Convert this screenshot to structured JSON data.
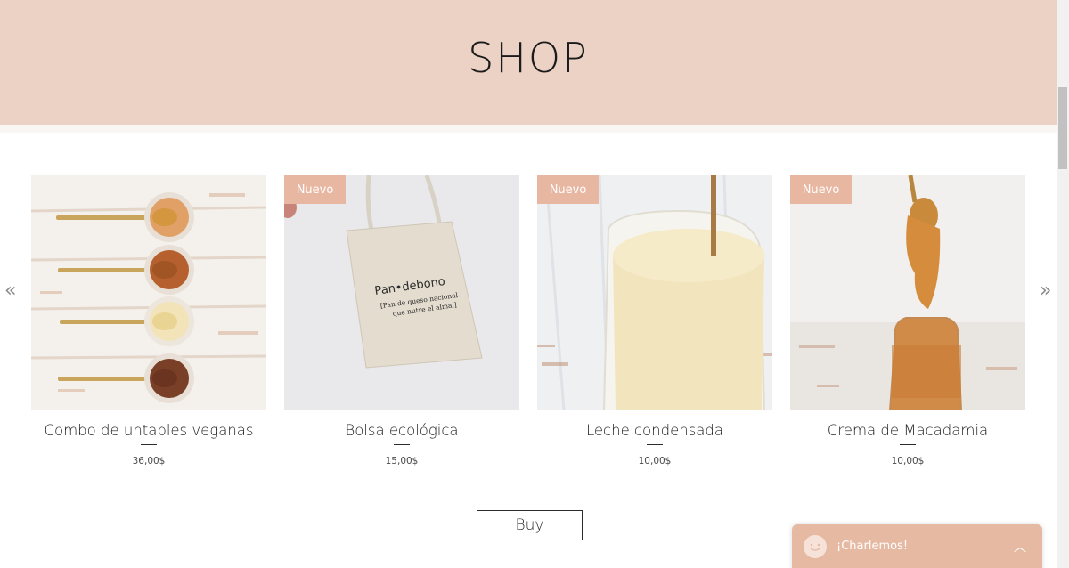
{
  "header": {
    "title": "SHOP"
  },
  "gallery": {
    "products": [
      {
        "name": "Combo de untables veganas",
        "price": "36,00$",
        "badge": ""
      },
      {
        "name": "Bolsa ecológica",
        "price": "15,00$",
        "badge": "Nuevo"
      },
      {
        "name": "Leche condensada",
        "price": "10,00$",
        "badge": "Nuevo"
      },
      {
        "name": "Crema de Macadamia",
        "price": "10,00$",
        "badge": "Nuevo"
      }
    ],
    "bag_print": {
      "line1": "Pan•debono",
      "line2": "[Pan de queso nacional",
      "line3": "que nutre el alma.]"
    },
    "prev_icon": "chevron-double-left-icon",
    "next_icon": "chevron-double-right-icon"
  },
  "buy": {
    "label": "Buy"
  },
  "chat": {
    "label": "¡Charlemos!",
    "icon": "smile-face-icon"
  },
  "colors": {
    "header_bg": "#ecd2c5",
    "badge_bg": "#e8b7a2",
    "chat_bg": "#e6b9a2"
  }
}
